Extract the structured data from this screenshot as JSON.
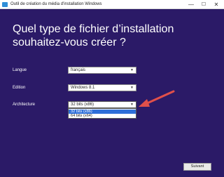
{
  "window": {
    "title": "Outil de création du média d'installation Windows",
    "controls": {
      "minimize": "—",
      "maximize": "☐",
      "close": "✕"
    }
  },
  "main": {
    "heading": "Quel type de fichier d’installation souhaitez-vous créer ?"
  },
  "fields": {
    "langue": {
      "label": "Langue",
      "value": "français"
    },
    "edition": {
      "label": "Edition",
      "value": "Windows 8.1"
    },
    "architecture": {
      "label": "Architecture",
      "value": "32 bits (x86)",
      "options": [
        "32 bits (x86)",
        "64 bits (x64)"
      ],
      "highlighted_index": 0
    }
  },
  "footer": {
    "next_label": "Suivant"
  },
  "colors": {
    "background": "#2b1a67",
    "highlight": "#2f6fd9",
    "annotation_arrow": "#e0504a"
  },
  "icons": {
    "dropdown": "chevron-down-icon",
    "annotation": "red-arrow"
  }
}
